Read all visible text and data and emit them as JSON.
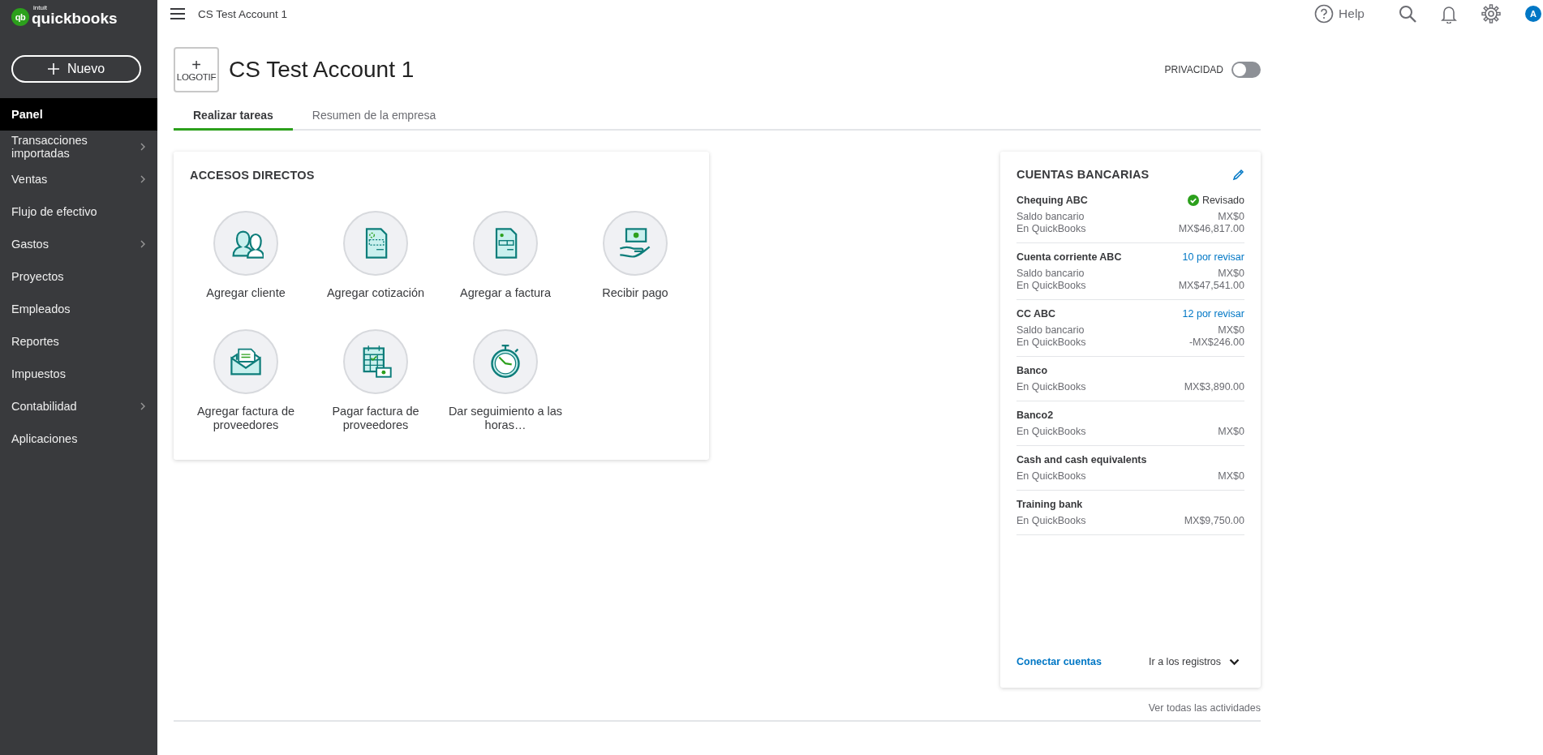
{
  "logo": {
    "mark": "qb",
    "brand": "intuit",
    "name": "quickbooks"
  },
  "new_button": {
    "label": "Nuevo"
  },
  "sidebar": {
    "items": [
      {
        "label": "Panel",
        "selected": true,
        "expandable": false
      },
      {
        "label": "Transacciones importadas",
        "selected": false,
        "expandable": true
      },
      {
        "label": "Ventas",
        "selected": false,
        "expandable": true
      },
      {
        "label": "Flujo de efectivo",
        "selected": false,
        "expandable": false
      },
      {
        "label": "Gastos",
        "selected": false,
        "expandable": true
      },
      {
        "label": "Proyectos",
        "selected": false,
        "expandable": false
      },
      {
        "label": "Empleados",
        "selected": false,
        "expandable": false
      },
      {
        "label": "Reportes",
        "selected": false,
        "expandable": false
      },
      {
        "label": "Impuestos",
        "selected": false,
        "expandable": false
      },
      {
        "label": "Contabilidad",
        "selected": false,
        "expandable": true
      },
      {
        "label": "Aplicaciones",
        "selected": false,
        "expandable": false
      }
    ]
  },
  "header": {
    "title": "CS Test Account 1",
    "help": "Help",
    "avatar": "A"
  },
  "company": {
    "logo_plus": "+",
    "logo_label": "LOGOTIF",
    "name": "CS Test Account 1",
    "privacy_label": "PRIVACIDAD",
    "privacy_on": false
  },
  "tabs": [
    {
      "label": "Realizar tareas",
      "selected": true
    },
    {
      "label": "Resumen de la empresa",
      "selected": false
    }
  ],
  "shortcuts": {
    "title": "ACCESOS DIRECTOS",
    "items": [
      {
        "label": "Agregar cliente"
      },
      {
        "label": "Agregar cotización"
      },
      {
        "label": "Agregar a factura"
      },
      {
        "label": "Recibir pago"
      },
      {
        "label": "Agregar factura de proveedores"
      },
      {
        "label": "Pagar factura de proveedores"
      },
      {
        "label": "Dar seguimiento a las horas…"
      }
    ]
  },
  "bank_accounts": {
    "title": "CUENTAS BANCARIAS",
    "accounts": [
      {
        "name": "Chequing ABC",
        "kind": "reviewed",
        "status": "Revisado",
        "rows": [
          {
            "label": "Saldo bancario",
            "value": "MX$0"
          },
          {
            "label": "En QuickBooks",
            "value": "MX$46,817.00"
          }
        ]
      },
      {
        "name": "Cuenta corriente ABC",
        "kind": "pending",
        "status": "10 por revisar",
        "rows": [
          {
            "label": "Saldo bancario",
            "value": "MX$0"
          },
          {
            "label": "En QuickBooks",
            "value": "MX$47,541.00"
          }
        ]
      },
      {
        "name": "CC ABC",
        "kind": "pending",
        "status": "12 por revisar",
        "rows": [
          {
            "label": "Saldo bancario",
            "value": "MX$0"
          },
          {
            "label": "En QuickBooks",
            "value": "-MX$246.00"
          }
        ]
      },
      {
        "name": "Banco",
        "kind": "plain",
        "rows": [
          {
            "label": "En QuickBooks",
            "value": "MX$3,890.00"
          }
        ]
      },
      {
        "name": "Banco2",
        "kind": "plain",
        "rows": [
          {
            "label": "En QuickBooks",
            "value": "MX$0"
          }
        ]
      },
      {
        "name": "Cash and cash equivalents",
        "kind": "plain",
        "rows": [
          {
            "label": "En QuickBooks",
            "value": "MX$0"
          }
        ]
      },
      {
        "name": "Training bank",
        "kind": "plain",
        "rows": [
          {
            "label": "En QuickBooks",
            "value": "MX$9,750.00"
          }
        ]
      }
    ],
    "connect_link": "Conectar cuentas",
    "registers_label": "Ir a los registros"
  },
  "activities_link": "Ver todas las actividades"
}
